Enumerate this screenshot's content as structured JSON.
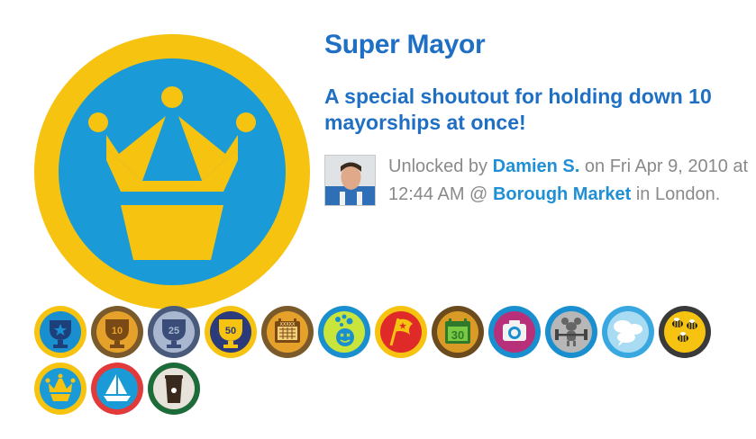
{
  "badge": {
    "name": "Super Mayor",
    "description": "A special shoutout for holding down 10 mayorships at once!",
    "icon": "crown-icon",
    "colors": {
      "ring": "#f7c311",
      "face": "#1a9ad6",
      "crown": "#f7c311"
    }
  },
  "unlock": {
    "prefix": "Unlocked by",
    "user": "Damien S.",
    "middle": "on Fri Apr 9, 2010 at 12:44 AM @",
    "venue": "Borough Market",
    "suffix": "in London."
  },
  "badges": [
    {
      "icon": "trophy-star-icon"
    },
    {
      "icon": "trophy-10-icon",
      "label": "10"
    },
    {
      "icon": "trophy-25-icon",
      "label": "25"
    },
    {
      "icon": "trophy-50-icon",
      "label": "50"
    },
    {
      "icon": "calendar-xxx-icon",
      "label": "XXXXX"
    },
    {
      "icon": "bubbles-smiley-icon"
    },
    {
      "icon": "flag-icon"
    },
    {
      "icon": "calendar-30-icon",
      "label": "30"
    },
    {
      "icon": "camera-icon"
    },
    {
      "icon": "weightlifting-mouse-icon"
    },
    {
      "icon": "speech-bubbles-icon"
    },
    {
      "icon": "bees-icon"
    },
    {
      "icon": "crown-icon"
    },
    {
      "icon": "sailboat-icon"
    },
    {
      "icon": "coffee-cup-icon"
    }
  ]
}
